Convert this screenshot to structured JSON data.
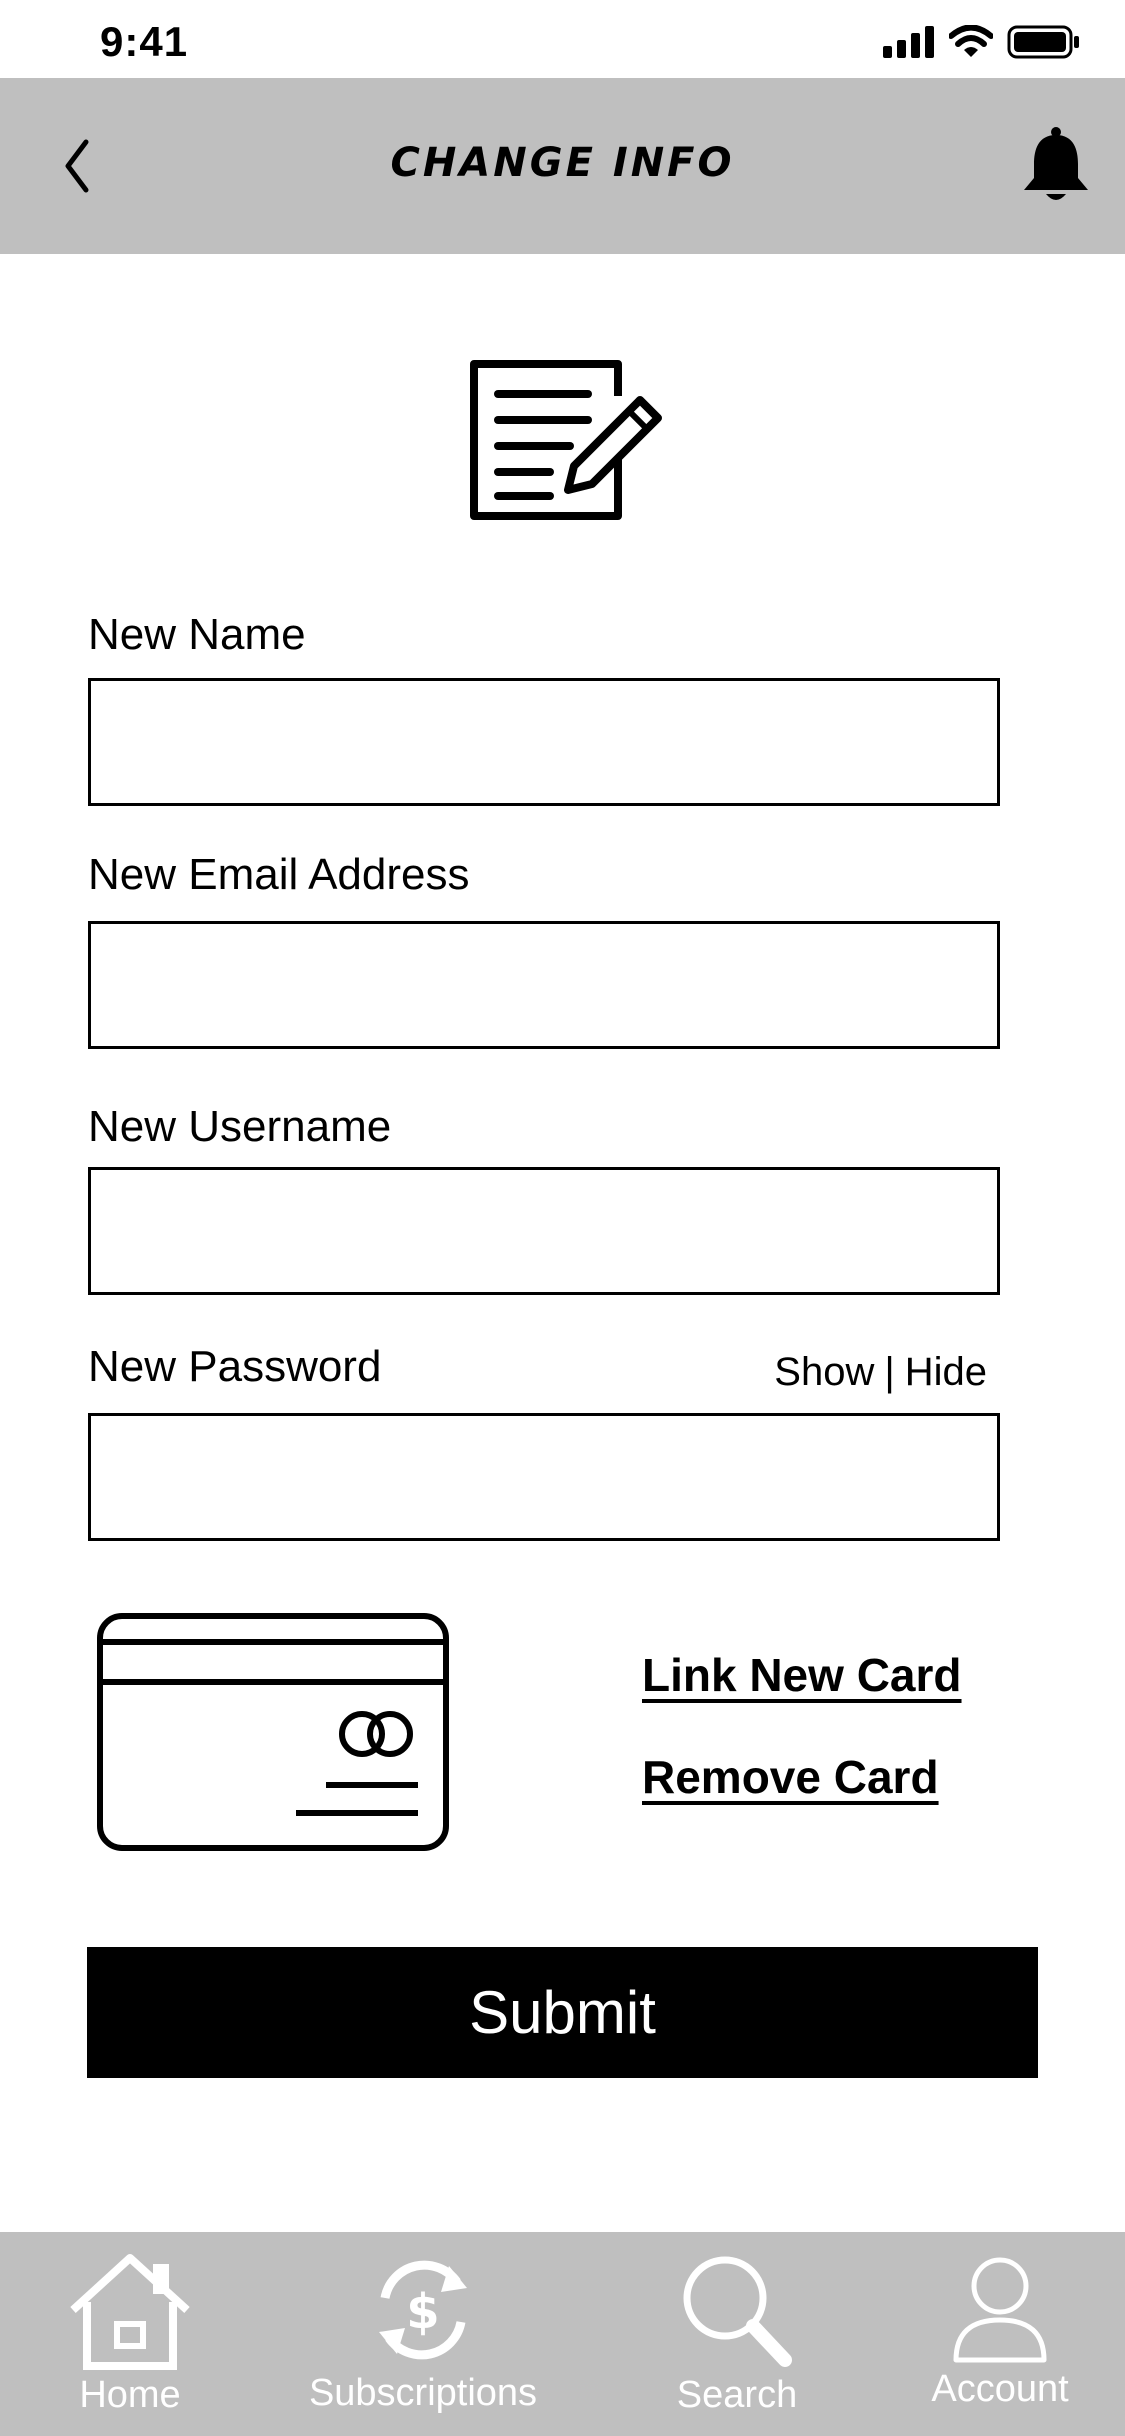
{
  "status_bar": {
    "time": "9:41"
  },
  "header": {
    "title": "CHANGE INFO"
  },
  "form": {
    "name_label": "New Name",
    "name_value": "",
    "email_label": "New Email Address",
    "email_value": "",
    "username_label": "New Username",
    "username_value": "",
    "password_label": "New Password",
    "password_value": "",
    "show_label": "Show",
    "separator": "|",
    "hide_label": "Hide"
  },
  "card": {
    "link_label": "Link New Card",
    "remove_label": "Remove Card"
  },
  "submit_label": "Submit",
  "nav": {
    "items": [
      {
        "label": "Home",
        "icon": "home-icon"
      },
      {
        "label": "Subscriptions",
        "icon": "subscriptions-icon"
      },
      {
        "label": "Search",
        "icon": "search-icon"
      },
      {
        "label": "Account",
        "icon": "account-icon"
      }
    ]
  },
  "colors": {
    "bar_gray": "#bfbfbf",
    "primary": "#000000",
    "nav_text": "#ffffff"
  }
}
